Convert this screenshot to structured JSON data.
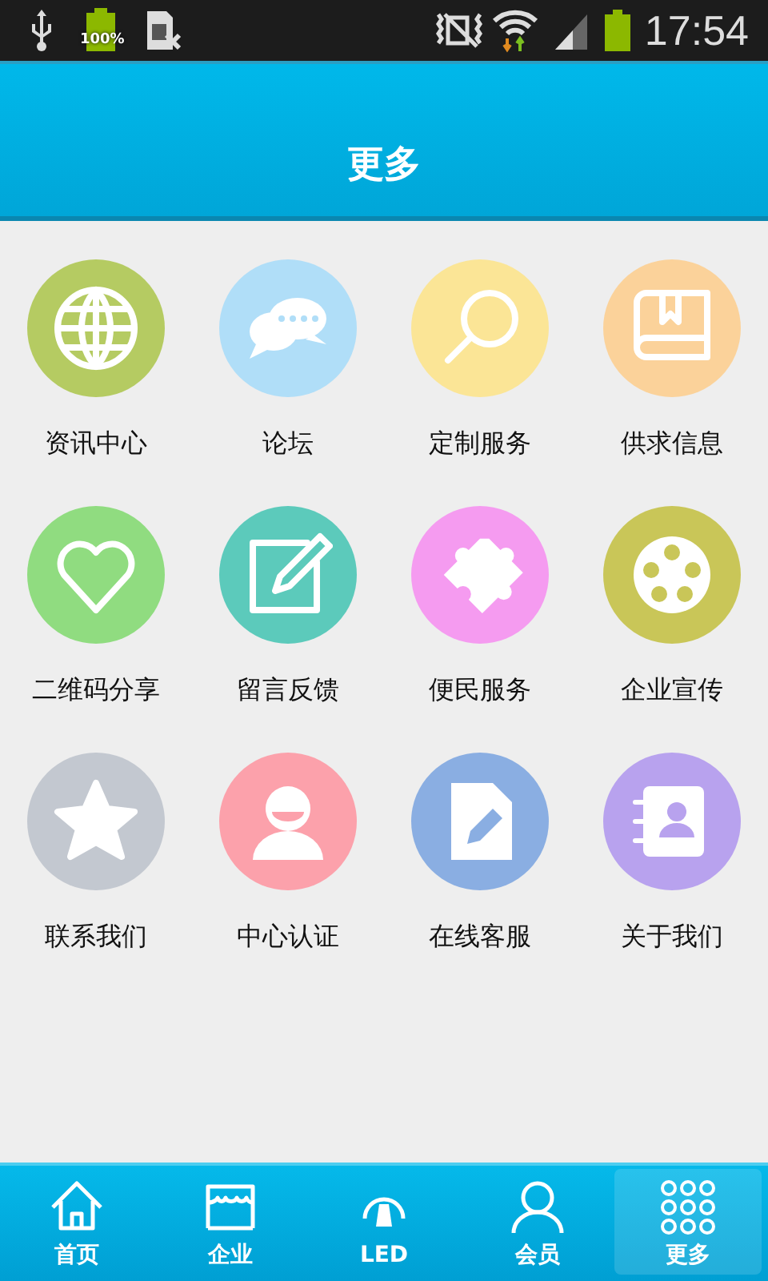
{
  "status_bar": {
    "battery_label": "100%",
    "time": "17:54"
  },
  "header": {
    "title": "更多"
  },
  "grid": [
    {
      "label": "资讯中心",
      "color": "#b5cb62"
    },
    {
      "label": "论坛",
      "color": "#b0def8"
    },
    {
      "label": "定制服务",
      "color": "#fbe596"
    },
    {
      "label": "供求信息",
      "color": "#fbd29a"
    },
    {
      "label": "二维码分享",
      "color": "#90dc80"
    },
    {
      "label": "留言反馈",
      "color": "#5ccabb"
    },
    {
      "label": "便民服务",
      "color": "#f59bf0"
    },
    {
      "label": "企业宣传",
      "color": "#c9c658"
    },
    {
      "label": "联系我们",
      "color": "#c3c8d0"
    },
    {
      "label": "中心认证",
      "color": "#fca1ab"
    },
    {
      "label": "在线客服",
      "color": "#8aaee2"
    },
    {
      "label": "关于我们",
      "color": "#b8a2ee"
    }
  ],
  "tab_bar": [
    {
      "label": "首页",
      "selected": false
    },
    {
      "label": "企业",
      "selected": false
    },
    {
      "label": "LED",
      "selected": false
    },
    {
      "label": "会员",
      "selected": false
    },
    {
      "label": "更多",
      "selected": true
    }
  ]
}
